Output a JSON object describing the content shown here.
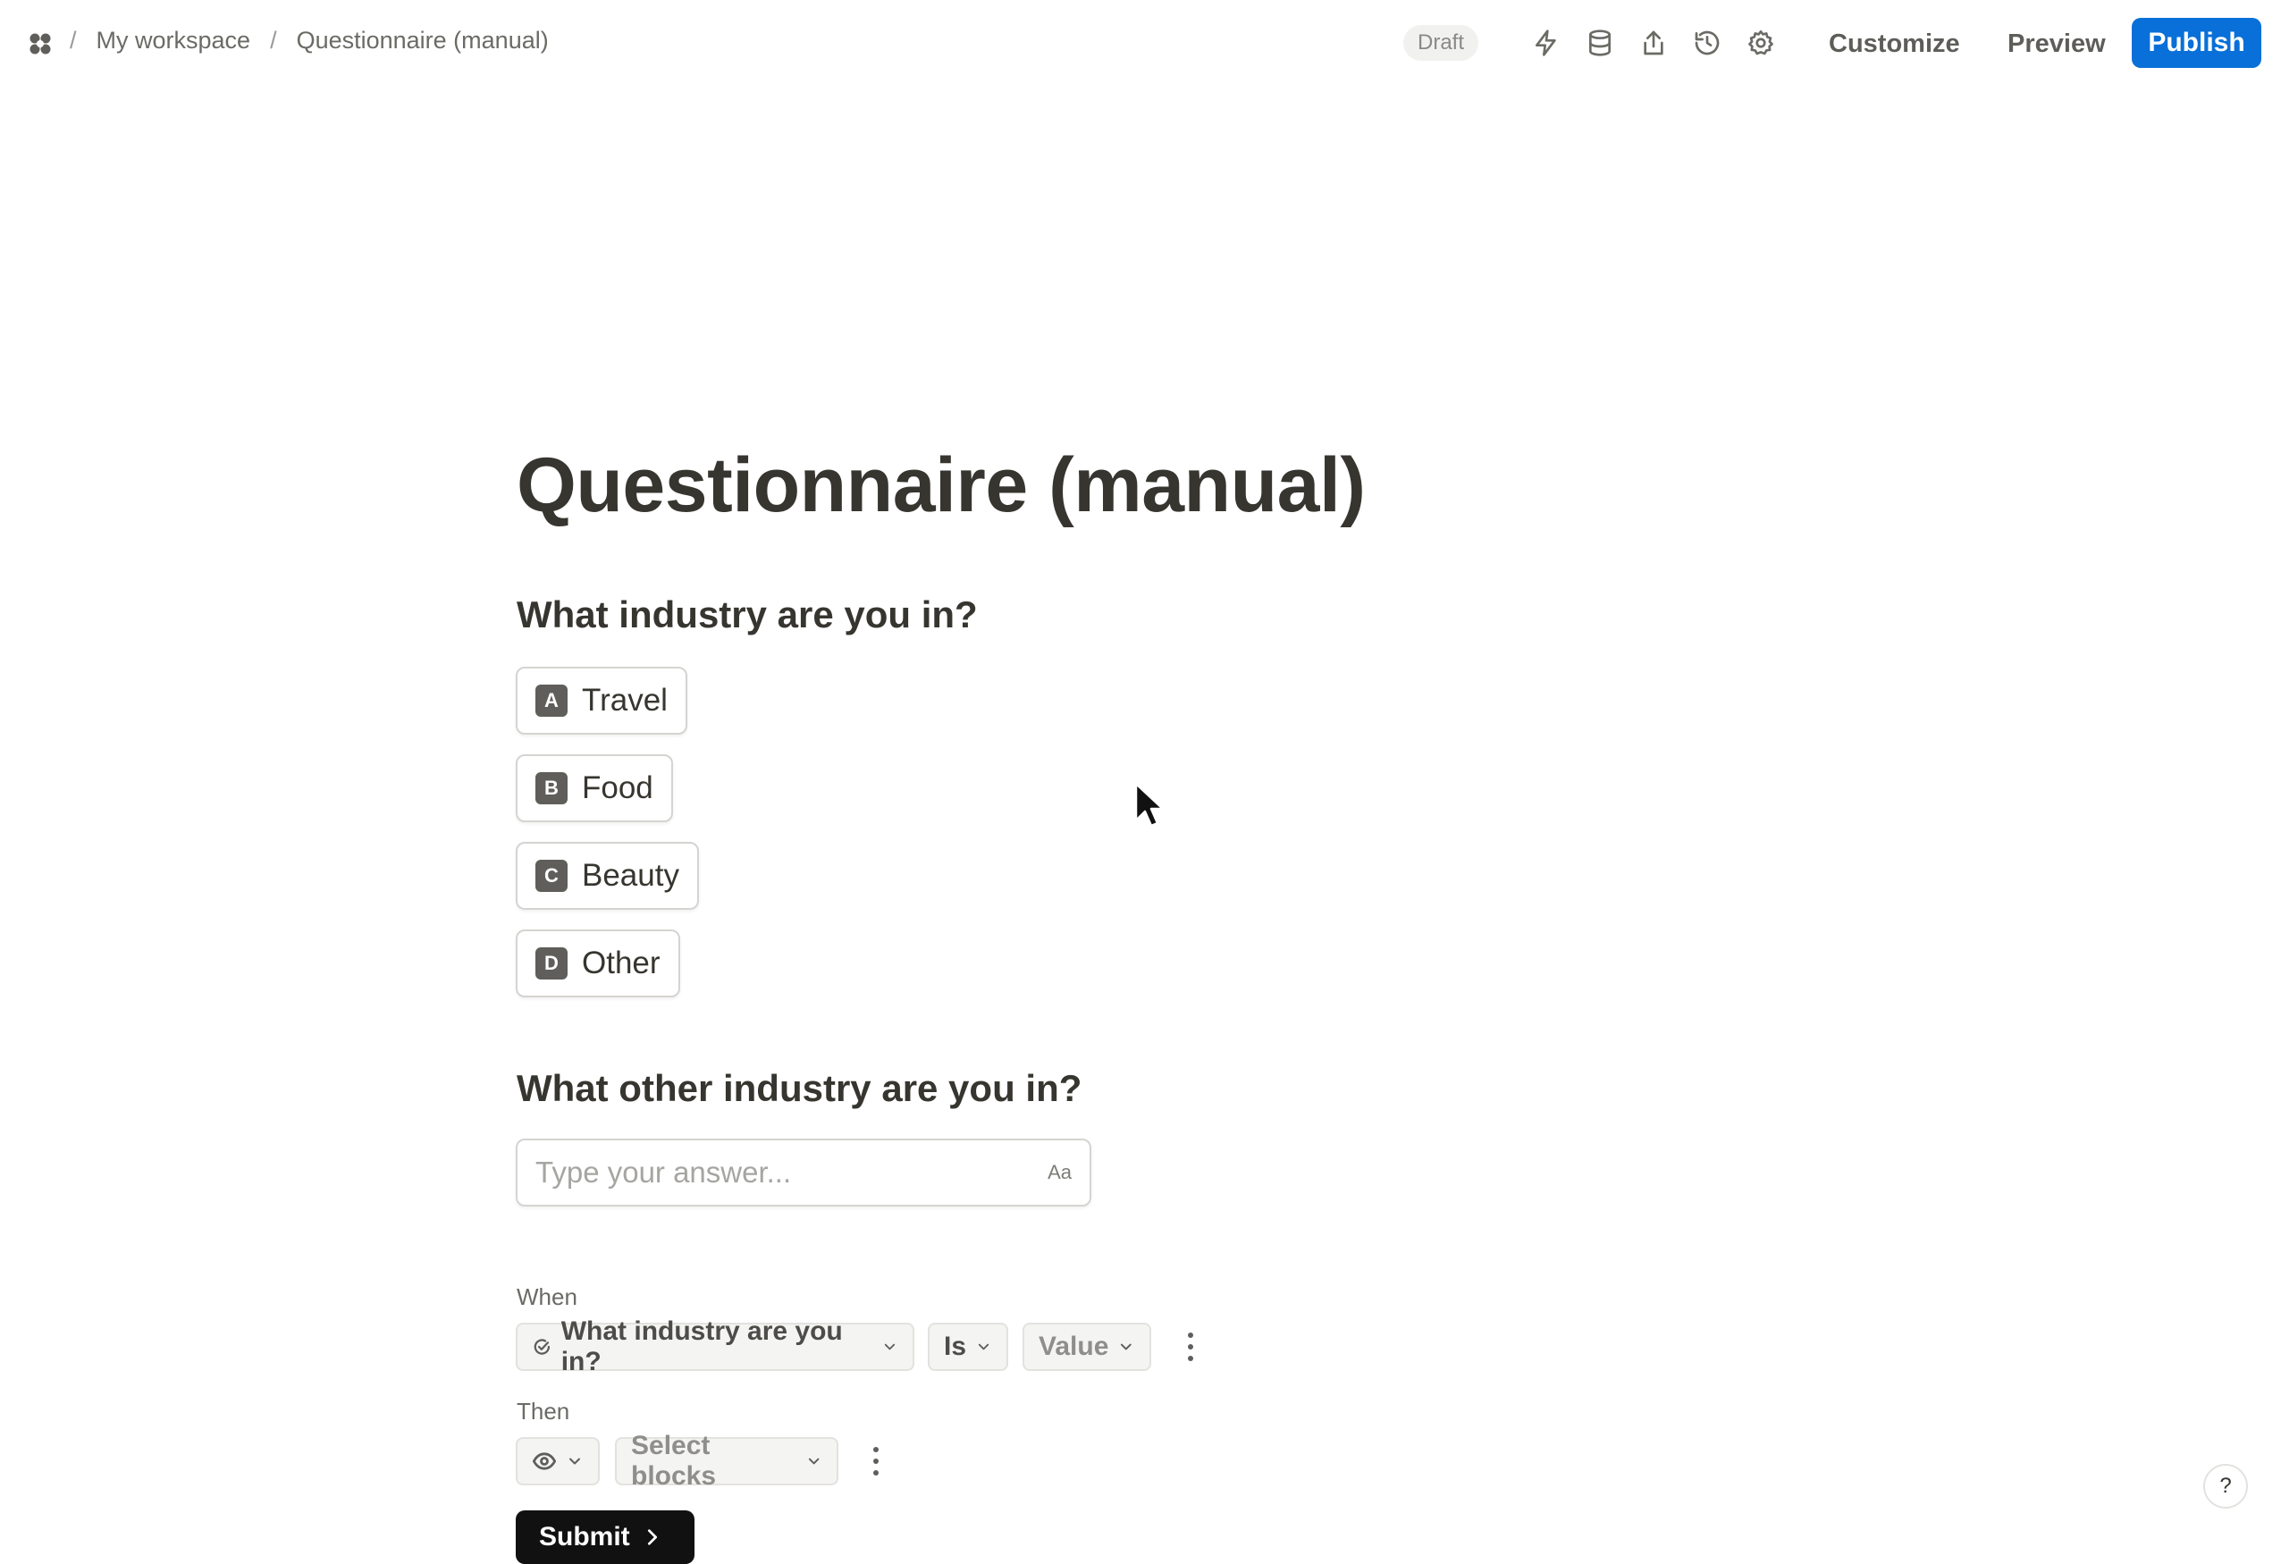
{
  "header": {
    "logo_icon": "workspace-flower-icon",
    "breadcrumb": [
      "My workspace",
      "Questionnaire (manual)"
    ],
    "separator": "/",
    "status": "Draft",
    "tools": [
      "bolt-icon",
      "database-icon",
      "share-icon",
      "history-icon",
      "gear-icon"
    ],
    "customize_label": "Customize",
    "preview_label": "Preview",
    "publish_label": "Publish",
    "publish_color": "#0870d8"
  },
  "form": {
    "title": "Questionnaire (manual)",
    "question1": {
      "label": "What industry are you in?",
      "options": [
        {
          "key": "A",
          "label": "Travel"
        },
        {
          "key": "B",
          "label": "Food"
        },
        {
          "key": "C",
          "label": "Beauty"
        },
        {
          "key": "D",
          "label": "Other"
        }
      ]
    },
    "question2": {
      "label": "What other industry are you in?",
      "placeholder": "Type your answer...",
      "type_badge": "Aa"
    },
    "logic": {
      "when_label": "When",
      "field": "What industry are you in?",
      "operator": "Is",
      "value": "Value",
      "then_label": "Then",
      "action_icon": "eye-icon",
      "target": "Select blocks"
    },
    "submit_label": "Submit"
  },
  "help_label": "?"
}
